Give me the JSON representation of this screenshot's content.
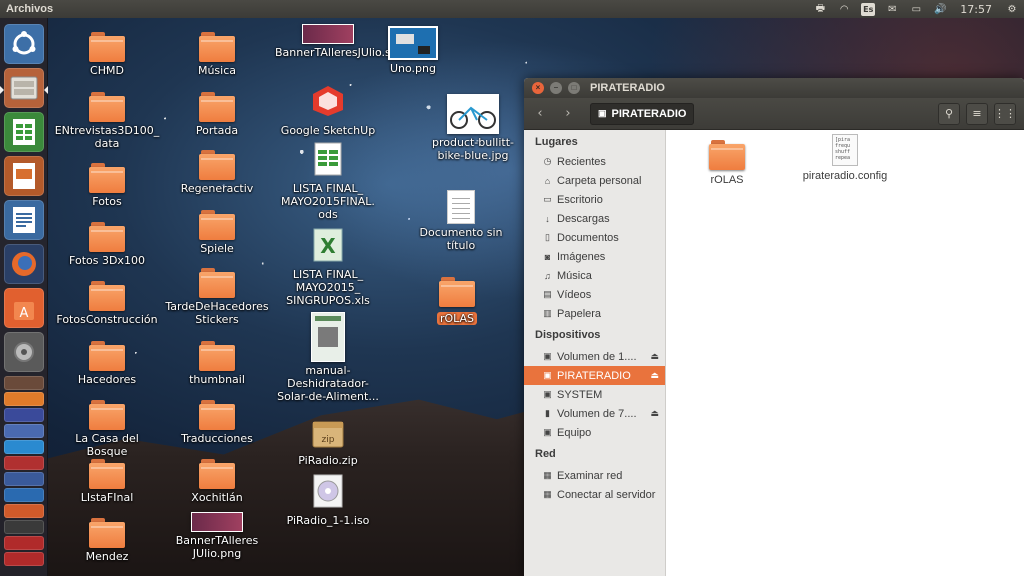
{
  "topbar": {
    "app_title": "Archivos",
    "keyboard_layout": "Es",
    "clock": "17:57"
  },
  "desktop": {
    "icons": [
      {
        "label": "CHMD",
        "type": "folder"
      },
      {
        "label": "ENtrevistas3D100_ data",
        "type": "folder"
      },
      {
        "label": "Fotos",
        "type": "folder"
      },
      {
        "label": "Fotos 3Dx100",
        "type": "folder"
      },
      {
        "label": "FotosConstrucción",
        "type": "folder"
      },
      {
        "label": "Hacedores",
        "type": "folder"
      },
      {
        "label": "La Casa del Bosque",
        "type": "folder"
      },
      {
        "label": "LIstaFInal",
        "type": "folder"
      },
      {
        "label": "Mendez",
        "type": "folder"
      },
      {
        "label": "Música",
        "type": "folder"
      },
      {
        "label": "Portada",
        "type": "folder"
      },
      {
        "label": "Regeneractiv",
        "type": "folder"
      },
      {
        "label": "Spiele",
        "type": "folder"
      },
      {
        "label": "TardeDeHacedores Stickers",
        "type": "folder"
      },
      {
        "label": "thumbnail",
        "type": "folder"
      },
      {
        "label": "Traducciones",
        "type": "folder"
      },
      {
        "label": "Xochitlán",
        "type": "folder"
      },
      {
        "label": "BannerTAlleres JUlio.png",
        "type": "image"
      },
      {
        "label": "BannerTAlleresJUlio.svg",
        "type": "image"
      },
      {
        "label": "Google SketchUp",
        "type": "app"
      },
      {
        "label": "LISTA FINAL_ MAYO2015FINAL. ods",
        "type": "spreadsheet"
      },
      {
        "label": "LISTA FINAL_ MAYO2015_ SINGRUPOS.xls",
        "type": "spreadsheet"
      },
      {
        "label": "manual-Deshidratador-Solar-de-Aliment...",
        "type": "document"
      },
      {
        "label": "PiRadio.zip",
        "type": "archive"
      },
      {
        "label": "PiRadio_1-1.iso",
        "type": "disc"
      },
      {
        "label": "Uno.png",
        "type": "image"
      },
      {
        "label": "product-bullitt-bike-blue.jpg",
        "type": "image"
      },
      {
        "label": "Documento sin título",
        "type": "document"
      },
      {
        "label": "rOLAS",
        "type": "folder",
        "selected": true
      }
    ]
  },
  "window": {
    "title": "PIRATERADIO",
    "path_button": "PIRATERADIO",
    "sidebar": {
      "places_header": "Lugares",
      "places": [
        {
          "label": "Recientes",
          "icon": "clock-icon"
        },
        {
          "label": "Carpeta personal",
          "icon": "home-icon"
        },
        {
          "label": "Escritorio",
          "icon": "desktop-icon"
        },
        {
          "label": "Descargas",
          "icon": "download-icon"
        },
        {
          "label": "Documentos",
          "icon": "document-icon"
        },
        {
          "label": "Imágenes",
          "icon": "camera-icon"
        },
        {
          "label": "Música",
          "icon": "music-icon"
        },
        {
          "label": "Vídeos",
          "icon": "film-icon"
        },
        {
          "label": "Papelera",
          "icon": "trash-icon"
        }
      ],
      "devices_header": "Dispositivos",
      "devices": [
        {
          "label": "Volumen de 1....",
          "icon": "drive-icon",
          "eject": true
        },
        {
          "label": "PIRATERADIO",
          "icon": "drive-icon",
          "eject": true,
          "active": true
        },
        {
          "label": "SYSTEM",
          "icon": "drive-icon",
          "eject": false
        },
        {
          "label": "Volumen de 7....",
          "icon": "usb-icon",
          "eject": true
        },
        {
          "label": "Equipo",
          "icon": "drive-icon",
          "eject": false
        }
      ],
      "network_header": "Red",
      "network": [
        {
          "label": "Examinar red",
          "icon": "network-icon"
        },
        {
          "label": "Conectar al servidor",
          "icon": "server-icon"
        }
      ]
    },
    "files": [
      {
        "label": "rOLAS",
        "type": "folder"
      },
      {
        "label": "pirateradio.config",
        "type": "text",
        "preview": "[pira\nfrequ\nshuff\nrepea"
      }
    ]
  }
}
